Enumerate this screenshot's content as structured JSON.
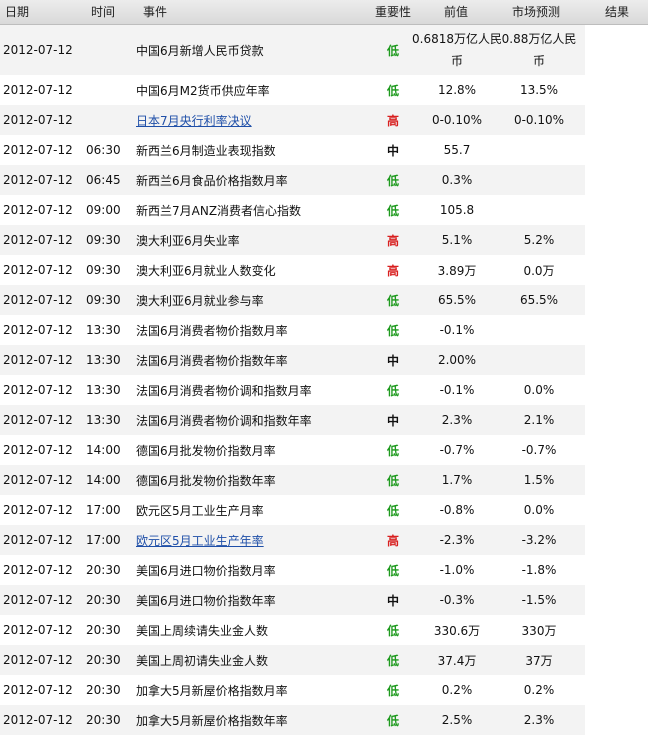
{
  "headers": {
    "date": "日期",
    "time": "时间",
    "event": "事件",
    "importance": "重要性",
    "previous": "前值",
    "forecast": "市场预测",
    "result": "结果"
  },
  "colors": {
    "low": "#1e9a1e",
    "medium": "#1a3ec9",
    "high": "#d81f1f",
    "link": "#1f4fa8"
  },
  "rows": [
    {
      "date": "2012-07-12",
      "time": "",
      "event": "中国6月新增人民币贷款",
      "link": false,
      "importance": "低",
      "level": "low",
      "previous": "0.6818万亿人民币",
      "forecast": "0.88万亿人民币"
    },
    {
      "date": "2012-07-12",
      "time": "",
      "event": "中国6月M2货币供应年率",
      "link": false,
      "importance": "低",
      "level": "low",
      "previous": "12.8%",
      "forecast": "13.5%"
    },
    {
      "date": "2012-07-12",
      "time": "",
      "event": "日本7月央行利率决议",
      "link": true,
      "importance": "高",
      "level": "high",
      "previous": "0-0.10%",
      "forecast": "0-0.10%"
    },
    {
      "date": "2012-07-12",
      "time": "06:30",
      "event": "新西兰6月制造业表现指数",
      "link": false,
      "importance": "中",
      "level": "medium",
      "previous": "55.7",
      "forecast": ""
    },
    {
      "date": "2012-07-12",
      "time": "06:45",
      "event": "新西兰6月食品价格指数月率",
      "link": false,
      "importance": "低",
      "level": "low",
      "previous": "0.3%",
      "forecast": ""
    },
    {
      "date": "2012-07-12",
      "time": "09:00",
      "event": "新西兰7月ANZ消费者信心指数",
      "link": false,
      "importance": "低",
      "level": "low",
      "previous": "105.8",
      "forecast": ""
    },
    {
      "date": "2012-07-12",
      "time": "09:30",
      "event": "澳大利亚6月失业率",
      "link": false,
      "importance": "高",
      "level": "high",
      "previous": "5.1%",
      "forecast": "5.2%"
    },
    {
      "date": "2012-07-12",
      "time": "09:30",
      "event": "澳大利亚6月就业人数变化",
      "link": false,
      "importance": "高",
      "level": "high",
      "previous": "3.89万",
      "forecast": "0.0万"
    },
    {
      "date": "2012-07-12",
      "time": "09:30",
      "event": "澳大利亚6月就业参与率",
      "link": false,
      "importance": "低",
      "level": "low",
      "previous": "65.5%",
      "forecast": "65.5%"
    },
    {
      "date": "2012-07-12",
      "time": "13:30",
      "event": "法国6月消费者物价指数月率",
      "link": false,
      "importance": "低",
      "level": "low",
      "previous": "-0.1%",
      "forecast": ""
    },
    {
      "date": "2012-07-12",
      "time": "13:30",
      "event": "法国6月消费者物价指数年率",
      "link": false,
      "importance": "中",
      "level": "medium",
      "previous": "2.00%",
      "forecast": ""
    },
    {
      "date": "2012-07-12",
      "time": "13:30",
      "event": "法国6月消费者物价调和指数月率",
      "link": false,
      "importance": "低",
      "level": "low",
      "previous": "-0.1%",
      "forecast": "0.0%"
    },
    {
      "date": "2012-07-12",
      "time": "13:30",
      "event": "法国6月消费者物价调和指数年率",
      "link": false,
      "importance": "中",
      "level": "medium",
      "previous": "2.3%",
      "forecast": "2.1%"
    },
    {
      "date": "2012-07-12",
      "time": "14:00",
      "event": "德国6月批发物价指数月率",
      "link": false,
      "importance": "低",
      "level": "low",
      "previous": "-0.7%",
      "forecast": "-0.7%"
    },
    {
      "date": "2012-07-12",
      "time": "14:00",
      "event": "德国6月批发物价指数年率",
      "link": false,
      "importance": "低",
      "level": "low",
      "previous": "1.7%",
      "forecast": "1.5%"
    },
    {
      "date": "2012-07-12",
      "time": "17:00",
      "event": "欧元区5月工业生产月率",
      "link": false,
      "importance": "低",
      "level": "low",
      "previous": "-0.8%",
      "forecast": "0.0%"
    },
    {
      "date": "2012-07-12",
      "time": "17:00",
      "event": "欧元区5月工业生产年率",
      "link": true,
      "importance": "高",
      "level": "high",
      "previous": "-2.3%",
      "forecast": "-3.2%"
    },
    {
      "date": "2012-07-12",
      "time": "20:30",
      "event": "美国6月进口物价指数月率",
      "link": false,
      "importance": "低",
      "level": "low",
      "previous": "-1.0%",
      "forecast": "-1.8%"
    },
    {
      "date": "2012-07-12",
      "time": "20:30",
      "event": "美国6月进口物价指数年率",
      "link": false,
      "importance": "中",
      "level": "medium",
      "previous": "-0.3%",
      "forecast": "-1.5%"
    },
    {
      "date": "2012-07-12",
      "time": "20:30",
      "event": "美国上周续请失业金人数",
      "link": false,
      "importance": "低",
      "level": "low",
      "previous": "330.6万",
      "forecast": "330万"
    },
    {
      "date": "2012-07-12",
      "time": "20:30",
      "event": "美国上周初请失业金人数",
      "link": false,
      "importance": "低",
      "level": "low",
      "previous": "37.4万",
      "forecast": "37万"
    },
    {
      "date": "2012-07-12",
      "time": "20:30",
      "event": "加拿大5月新屋价格指数月率",
      "link": false,
      "importance": "低",
      "level": "low",
      "previous": "0.2%",
      "forecast": "0.2%"
    },
    {
      "date": "2012-07-12",
      "time": "20:30",
      "event": "加拿大5月新屋价格指数年率",
      "link": false,
      "importance": "低",
      "level": "low",
      "previous": "2.5%",
      "forecast": "2.3%"
    }
  ]
}
